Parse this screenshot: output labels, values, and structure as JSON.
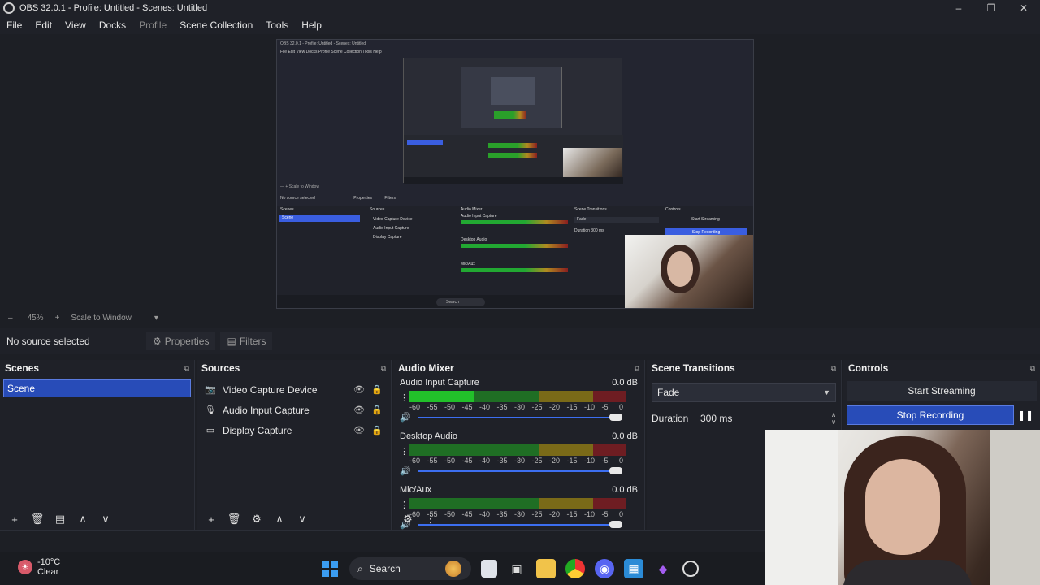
{
  "window": {
    "title": "OBS 32.0.1 - Profile: Untitled - Scenes: Untitled",
    "controls": [
      "–",
      "❐",
      "✕"
    ]
  },
  "menu": [
    "File",
    "Edit",
    "View",
    "Docks",
    "Profile",
    "Scene Collection",
    "Tools",
    "Help"
  ],
  "mini": {
    "title": "OBS 32.0.1 - Profile: Untitled - Scenes: Untitled",
    "menu": "File  Edit  View  Docks  Profile  Scene Collection  Tools  Help",
    "scale": "— + Scale to Window",
    "no_source": "No source selected",
    "props": "Properties",
    "filters": "Filters",
    "headers": [
      "Scenes",
      "Sources",
      "Audio Mixer",
      "Scene Transitions",
      "Controls"
    ],
    "scene": "Scene",
    "sources": [
      "Video Capture Device",
      "Audio Input Capture",
      "Display Capture"
    ],
    "channels": [
      "Audio Input Capture",
      "Desktop Audio",
      "Mic/Aux"
    ],
    "fade": "Fade",
    "duration": "Duration   300 ms",
    "start_streaming": "Start Streaming",
    "stop_recording": "Stop Recording",
    "search": "Search"
  },
  "zoombar": {
    "minus": "–",
    "zoom": "45%",
    "plus": "+",
    "mode": "Scale to Window"
  },
  "source_toolbar": {
    "no_source": "No source selected",
    "properties": "Properties",
    "filters": "Filters"
  },
  "scenes": {
    "title": "Scenes",
    "items": [
      "Scene"
    ]
  },
  "sources": {
    "title": "Sources",
    "items": [
      {
        "name": "Video Capture Device",
        "icon": "camera-icon"
      },
      {
        "name": "Audio Input Capture",
        "icon": "microphone-icon"
      },
      {
        "name": "Display Capture",
        "icon": "monitor-icon"
      }
    ]
  },
  "mixer": {
    "title": "Audio Mixer",
    "ticks": [
      "-60",
      "-55",
      "-50",
      "-45",
      "-40",
      "-35",
      "-30",
      "-25",
      "-20",
      "-15",
      "-10",
      "-5",
      "0"
    ],
    "channels": [
      {
        "name": "Audio Input Capture",
        "db": "0.0 dB",
        "level": 0.3,
        "volume": 1.0
      },
      {
        "name": "Desktop Audio",
        "db": "0.0 dB",
        "level": 0.0,
        "volume": 1.0
      },
      {
        "name": "Mic/Aux",
        "db": "0.0 dB",
        "level": 0.0,
        "volume": 1.0
      }
    ]
  },
  "transitions": {
    "title": "Scene Transitions",
    "selected": "Fade",
    "duration_label": "Duration",
    "duration_value": "300 ms"
  },
  "controls": {
    "title": "Controls",
    "start_streaming": "Start Streaming",
    "stop_recording": "Stop Recording"
  },
  "taskbar": {
    "temp": "-10°C",
    "condition": "Clear",
    "search": "Search"
  },
  "colors": {
    "accent": "#284cb8",
    "meter_green": "#22c02a",
    "meter_yellow": "#c9a21a",
    "meter_red": "#b8202a"
  }
}
